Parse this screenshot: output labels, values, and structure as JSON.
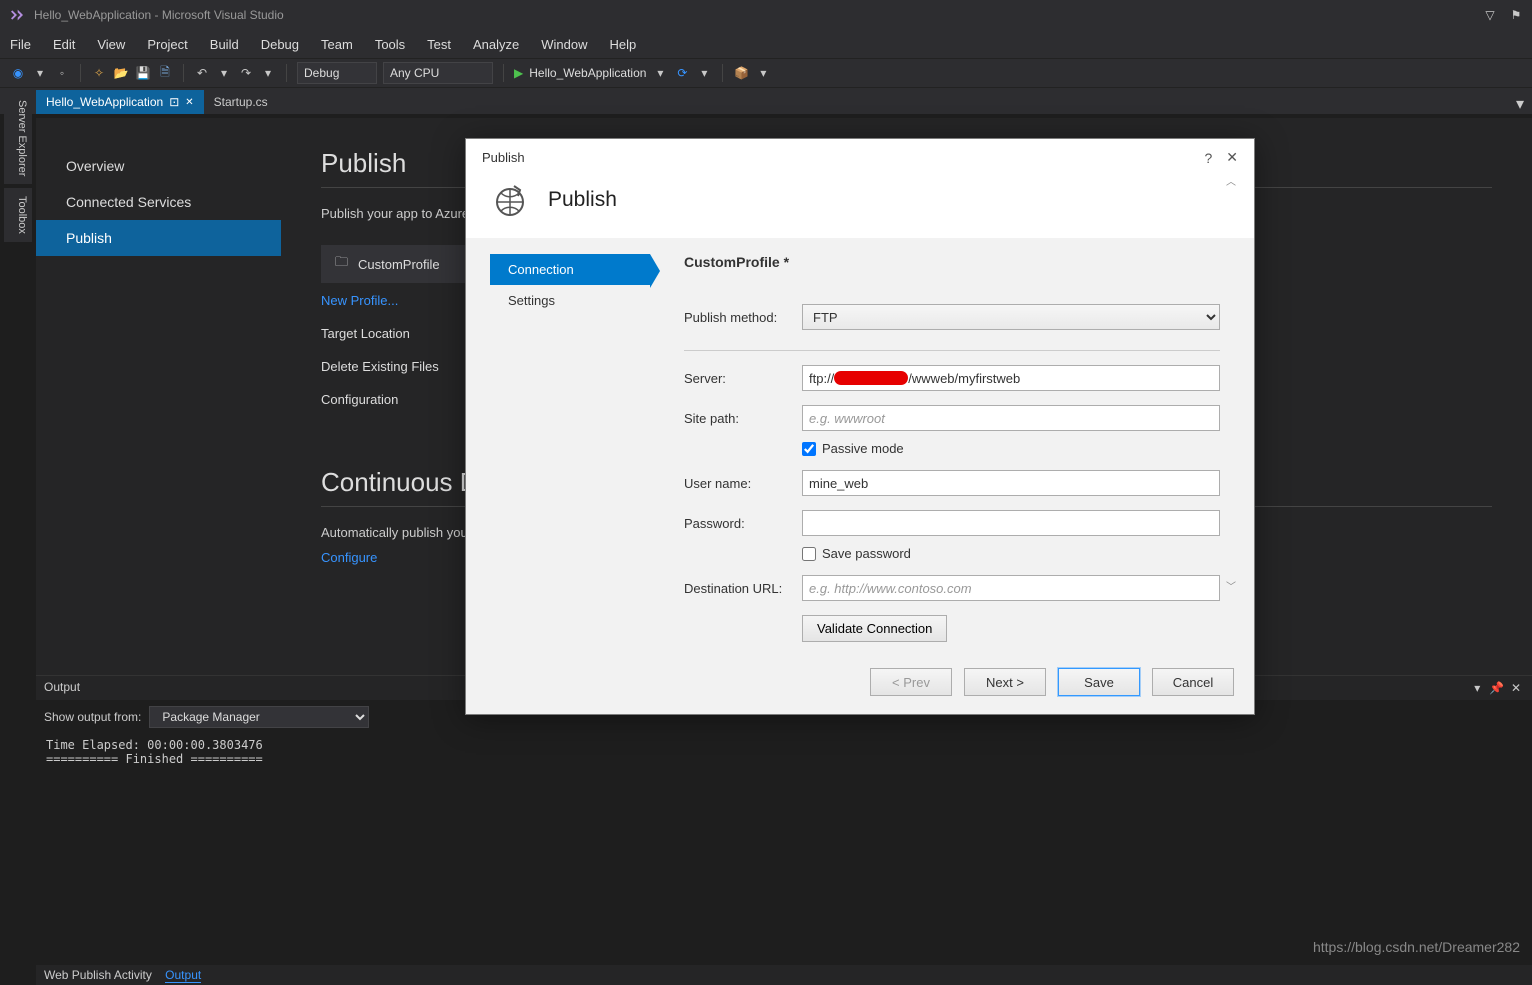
{
  "titlebar": {
    "title": "Hello_WebApplication - Microsoft Visual Studio"
  },
  "menu": {
    "items": [
      "File",
      "Edit",
      "View",
      "Project",
      "Build",
      "Debug",
      "Team",
      "Tools",
      "Test",
      "Analyze",
      "Window",
      "Help"
    ]
  },
  "toolbar": {
    "configuration": "Debug",
    "platform": "Any CPU",
    "debug_target": "Hello_WebApplication"
  },
  "tabs": {
    "items": [
      {
        "label": "Hello_WebApplication",
        "active": true
      },
      {
        "label": "Startup.cs",
        "active": false
      }
    ]
  },
  "sidetools": {
    "items": [
      "Server Explorer",
      "Toolbox"
    ]
  },
  "nav": {
    "items": [
      {
        "label": "Overview",
        "active": false
      },
      {
        "label": "Connected Services",
        "active": false
      },
      {
        "label": "Publish",
        "active": true
      }
    ]
  },
  "publish": {
    "heading": "Publish",
    "hint": "Publish your app to Azure",
    "profile_label": "CustomProfile",
    "new_profile": "New Profile...",
    "target_location": "Target Location",
    "delete_existing": "Delete Existing Files",
    "configuration": "Configuration",
    "cd_heading": "Continuous Deliv",
    "cd_hint": "Automatically publish you",
    "configure": "Configure"
  },
  "dialog": {
    "win_title": "Publish",
    "heading": "Publish",
    "steps": {
      "connection": "Connection",
      "settings": "Settings"
    },
    "profile_name": "CustomProfile *",
    "labels": {
      "publish_method": "Publish method:",
      "server": "Server:",
      "site_path": "Site path:",
      "passive": "Passive mode",
      "username": "User name:",
      "password": "Password:",
      "save_password": "Save password",
      "destination_url": "Destination URL:"
    },
    "values": {
      "publish_method": "FTP",
      "server_prefix": "ftp://",
      "server_suffix": "/wwweb/myfirstweb",
      "site_path_placeholder": "e.g. wwwroot",
      "passive_checked": true,
      "username": "mine_web",
      "password": "",
      "save_password_checked": false,
      "destination_placeholder": "e.g. http://www.contoso.com"
    },
    "buttons": {
      "validate": "Validate Connection",
      "prev": "< Prev",
      "next": "Next >",
      "save": "Save",
      "cancel": "Cancel"
    }
  },
  "output": {
    "title": "Output",
    "show_from_label": "Show output from:",
    "show_from": "Package Manager",
    "text": "Time Elapsed: 00:00:00.3803476\n========== Finished ==========",
    "bottom_tabs": {
      "wpa": "Web Publish Activity",
      "out": "Output"
    }
  },
  "watermark": "https://blog.csdn.net/Dreamer282"
}
